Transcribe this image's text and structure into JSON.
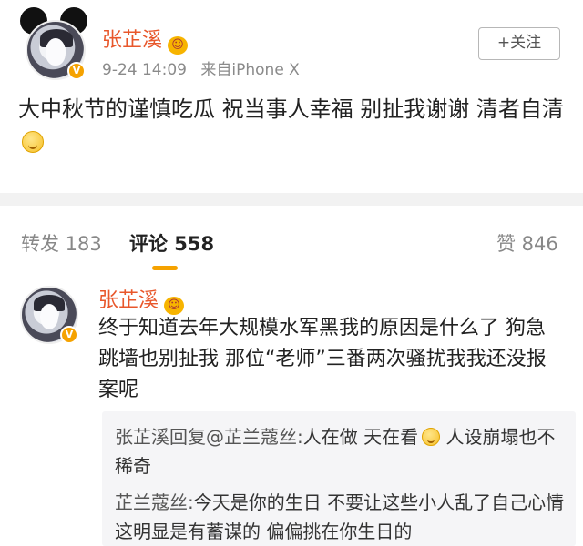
{
  "post": {
    "author": "张芷溪",
    "time": "9-24 14:09",
    "source": "来自iPhone X",
    "follow_label": "+关注",
    "text": "大中秋节的谨慎吃瓜 祝当事人幸福 别扯我谢谢 清者自清"
  },
  "tabs": {
    "repost": "转发 183",
    "comments": "评论 558",
    "likes": "赞 846"
  },
  "comment": {
    "author": "张芷溪",
    "text": "终于知道去年大规模水军黑我的原因是什么了 狗急跳墙也别扯我 那位“老师”三番两次骚扰我我还没报案呢",
    "replies": [
      {
        "author": "张芷溪回复@芷兰蔻丝:",
        "text": "人在做 天在看",
        "text_after_emoji": "人设崩塌也不稀奇"
      },
      {
        "author": "芷兰蔻丝:",
        "text": "今天是你的生日 不要让这些小人乱了自己心情 这明显是有蓄谋的 偏偏挑在你生日的"
      }
    ]
  },
  "icons": {
    "verified_badge": "verified-v-icon",
    "crown": "crown-icon",
    "emoji": "smile-emoji-icon"
  },
  "colors": {
    "accent": "#e8572b",
    "badge": "#f5a200",
    "divider": "#f2f2f2"
  }
}
